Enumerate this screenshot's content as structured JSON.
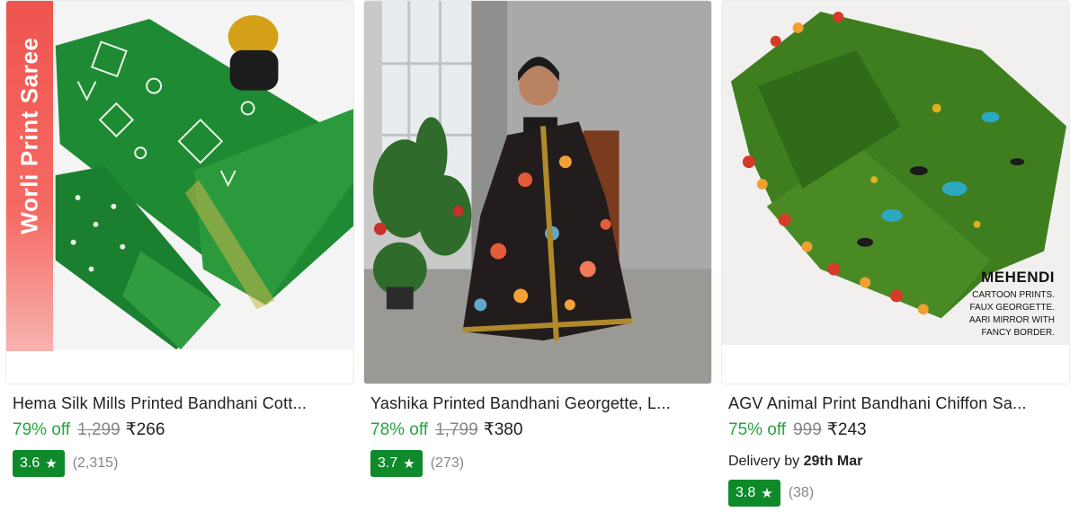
{
  "products": [
    {
      "title": "Hema Silk Mills Printed Bandhani Cott...",
      "discount": "79% off",
      "mrp": "1,299",
      "price": "₹266",
      "rating": "3.6",
      "rating_count": "(2,315)",
      "image_label": "Worli Print Saree",
      "image_icon": "green-worli-saree-image"
    },
    {
      "title": "Yashika Printed Bandhani Georgette, L...",
      "discount": "78% off",
      "mrp": "1,799",
      "price": "₹380",
      "rating": "3.7",
      "rating_count": "(273)",
      "image_icon": "model-in-floral-saree-image"
    },
    {
      "title": "AGV Animal Print Bandhani Chiffon Sa...",
      "discount": "75% off",
      "mrp": "999",
      "price": "₹243",
      "delivery_prefix": "Delivery by ",
      "delivery_date": "29th Mar",
      "rating": "3.8",
      "rating_count": "(38)",
      "image_overlay": {
        "heading": "MEHENDI",
        "lines": [
          "CARTOON PRINTS.",
          "FAUX GEORGETTE.",
          "AARI MIRROR WITH",
          "FANCY BORDER."
        ]
      },
      "image_icon": "mehendi-animal-print-saree-image"
    }
  ],
  "colors": {
    "discount": "#26a541",
    "rating_badge": "#0f8a2b",
    "muted": "#878787",
    "banner": "#f0544f"
  }
}
